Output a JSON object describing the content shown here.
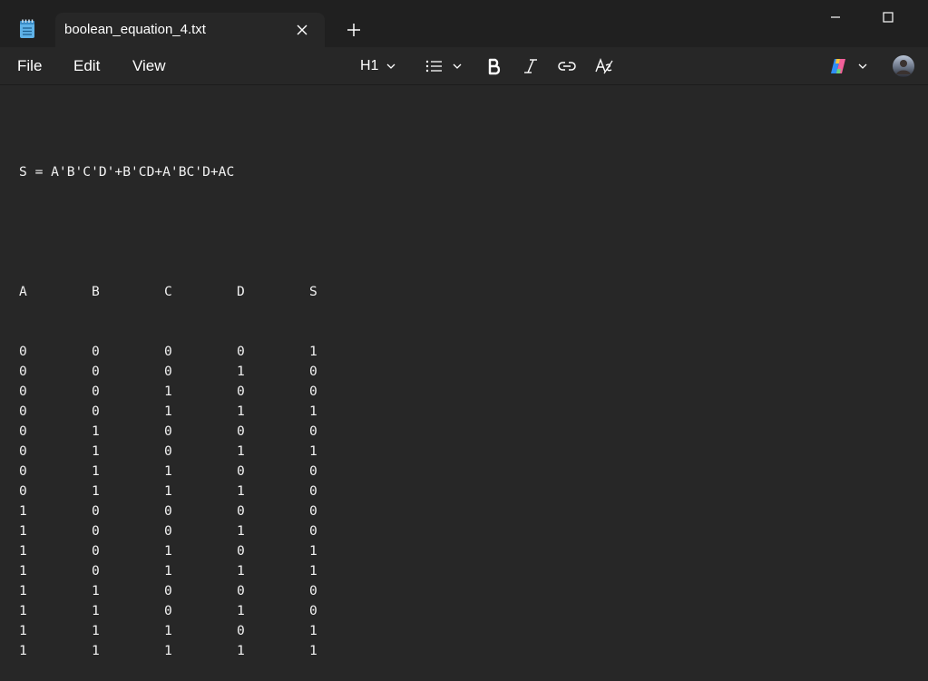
{
  "tab": {
    "title": "boolean_equation_4.txt"
  },
  "menu": {
    "file": "File",
    "edit": "Edit",
    "view": "View"
  },
  "toolbar": {
    "heading_label": "H1"
  },
  "document": {
    "equation": "S = A'B'C'D'+B'CD+A'BC'D+AC",
    "headers": [
      "A",
      "B",
      "C",
      "D",
      "S"
    ],
    "rows": [
      [
        "0",
        "0",
        "0",
        "0",
        "1"
      ],
      [
        "0",
        "0",
        "0",
        "1",
        "0"
      ],
      [
        "0",
        "0",
        "1",
        "0",
        "0"
      ],
      [
        "0",
        "0",
        "1",
        "1",
        "1"
      ],
      [
        "0",
        "1",
        "0",
        "0",
        "0"
      ],
      [
        "0",
        "1",
        "0",
        "1",
        "1"
      ],
      [
        "0",
        "1",
        "1",
        "0",
        "0"
      ],
      [
        "0",
        "1",
        "1",
        "1",
        "0"
      ],
      [
        "1",
        "0",
        "0",
        "0",
        "0"
      ],
      [
        "1",
        "0",
        "0",
        "1",
        "0"
      ],
      [
        "1",
        "0",
        "1",
        "0",
        "1"
      ],
      [
        "1",
        "0",
        "1",
        "1",
        "1"
      ],
      [
        "1",
        "1",
        "0",
        "0",
        "0"
      ],
      [
        "1",
        "1",
        "0",
        "1",
        "0"
      ],
      [
        "1",
        "1",
        "1",
        "0",
        "1"
      ],
      [
        "1",
        "1",
        "1",
        "1",
        "1"
      ]
    ]
  },
  "icons": {
    "app": "notepad-icon",
    "close_tab": "close-icon",
    "new_tab": "plus-icon",
    "minimize": "minimize-icon",
    "maximize": "maximize-icon",
    "list": "list-icon",
    "bold": "bold-icon",
    "italic": "italic-icon",
    "link": "link-icon",
    "clear_format": "clear-formatting-icon",
    "copilot": "copilot-icon",
    "avatar": "avatar"
  },
  "colors": {
    "background": "#272727",
    "titlebar": "#202020",
    "text": "#ffffff",
    "app_icon": "#5fb2e8"
  }
}
